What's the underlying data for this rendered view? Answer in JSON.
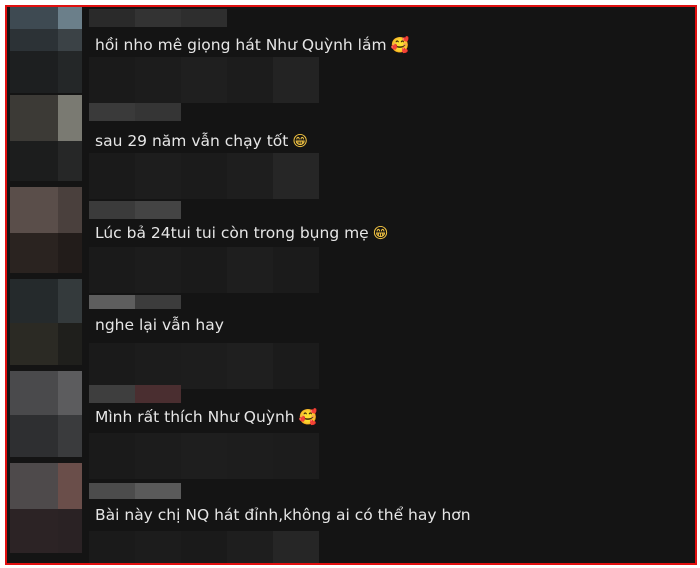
{
  "comments": [
    {
      "text": "hồi nho mê giọng hát Như Quỳnh lắm",
      "emoji": "🥰",
      "emoji_name": "smiling-face-with-hearts"
    },
    {
      "text": "sau 29 năm vẫn chạy tốt",
      "emoji": "😁",
      "emoji_name": "beaming-face"
    },
    {
      "text": "Lúc bả 24tui tui còn trong bụng mẹ",
      "emoji": "😁",
      "emoji_name": "beaming-face"
    },
    {
      "text": "nghe lại vẫn hay",
      "emoji": "",
      "emoji_name": ""
    },
    {
      "text": "Mình rất thích Như Quỳnh",
      "emoji": "🥰",
      "emoji_name": "smiling-face-with-hearts"
    },
    {
      "text": "Bài này chị NQ hát đỉnh,không ai có thể hay hơn",
      "emoji": "",
      "emoji_name": ""
    }
  ],
  "colors": {
    "frame_border": "#e01010",
    "background": "#141414",
    "text": "#e6e6e6"
  }
}
